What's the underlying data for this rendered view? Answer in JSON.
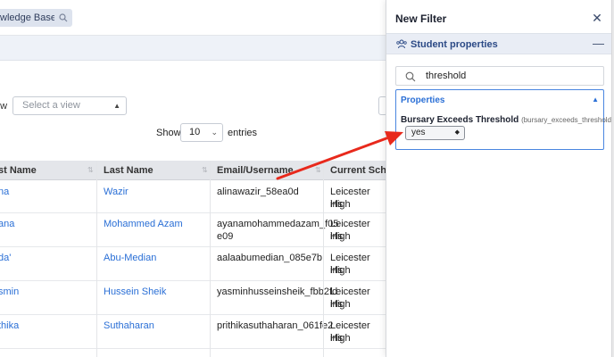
{
  "topbar": {
    "kb_label": "wledge Base",
    "search_icon": "search-icon"
  },
  "toolbar": {
    "view_label": "ew",
    "view_placeholder": "Select a view",
    "show_label": "Show",
    "entries_value": "10",
    "entries_label": "entries"
  },
  "table": {
    "headers": [
      "st Name",
      "Last Name",
      "Email/Username",
      "Current Schoo"
    ],
    "rows": [
      {
        "first": "na",
        "last": "Wazir",
        "email": [
          "alinawazir_58ea0d"
        ],
        "school": [
          "Leicester High",
          "irls"
        ]
      },
      {
        "first": "ana",
        "last": "Mohammed Azam",
        "email": [
          "ayanamohammedazam_f05",
          "e09"
        ],
        "school": [
          "Leicester High",
          "irls"
        ]
      },
      {
        "first": "da'",
        "last": "Abu-Median",
        "email": [
          "aalaabumedian_085e7b"
        ],
        "school": [
          "Leicester High",
          "irls"
        ]
      },
      {
        "first": "smin",
        "last": "Hussein Sheik",
        "email": [
          "yasminhusseinsheik_fbb2fd"
        ],
        "school": [
          "Leicester High",
          "irls"
        ]
      },
      {
        "first": "thika",
        "last": "Suthaharan",
        "email": [
          "prithikasuthaharan_061fe2"
        ],
        "school": [
          "Leicester High",
          "irls"
        ]
      }
    ]
  },
  "panel": {
    "title": "New Filter",
    "close_icon": "close-icon",
    "section_label": "Student properties",
    "section_icon": "users-icon",
    "search_value": "threshold",
    "props_title": "Properties",
    "property_name": "Bursary Exceeds Threshold",
    "property_key": "(bursary_exceeds_threshold)",
    "property_value": "yes"
  },
  "colors": {
    "link": "#2a6fd6",
    "accent_border": "#4a86e0",
    "annotation_arrow": "#e8291c"
  }
}
